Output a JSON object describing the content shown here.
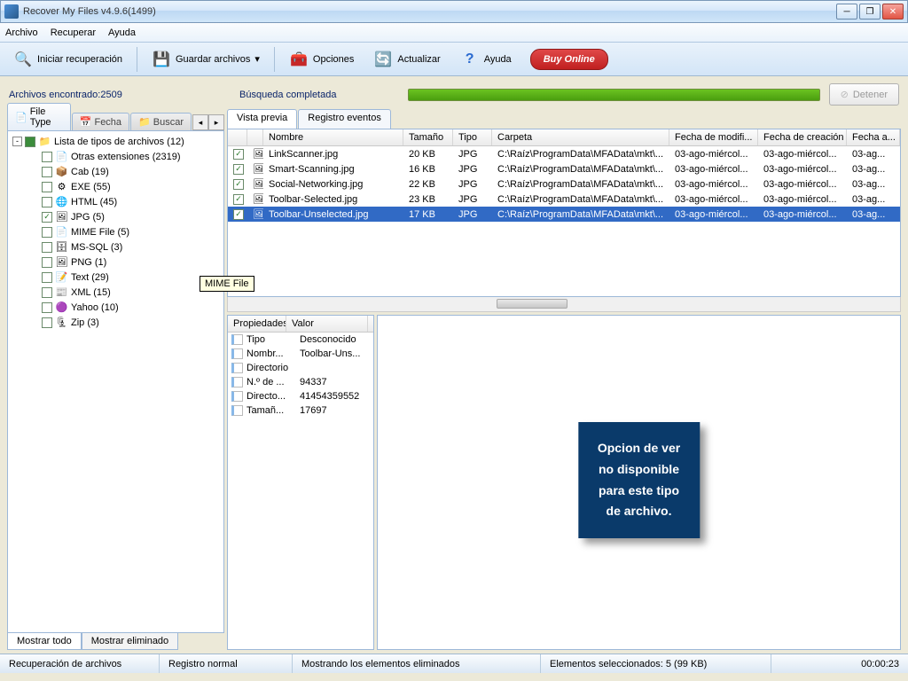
{
  "title": "Recover My Files v4.9.6(1499)",
  "menu": [
    "Archivo",
    "Recuperar",
    "Ayuda"
  ],
  "toolbar": {
    "start": "Iniciar recuperación",
    "save": "Guardar archivos",
    "options": "Opciones",
    "refresh": "Actualizar",
    "help": "Ayuda",
    "buy": "Buy Online"
  },
  "status": {
    "found": "Archivos encontrado:2509",
    "search": "Búsqueda completada",
    "stop": "Detener"
  },
  "lefttabs": {
    "filetype": "File Type",
    "fecha": "Fecha",
    "buscar": "Buscar"
  },
  "tree": [
    {
      "indent": 0,
      "exp": "-",
      "chk": "filled",
      "icon": "📁",
      "label": "Lista de tipos de archivos (12)"
    },
    {
      "indent": 1,
      "exp": "",
      "chk": "",
      "icon": "📄",
      "label": "Otras extensiones (2319)"
    },
    {
      "indent": 1,
      "exp": "",
      "chk": "",
      "icon": "📦",
      "label": "Cab (19)"
    },
    {
      "indent": 1,
      "exp": "",
      "chk": "",
      "icon": "⚙",
      "label": "EXE (55)"
    },
    {
      "indent": 1,
      "exp": "",
      "chk": "",
      "icon": "🌐",
      "label": "HTML (45)"
    },
    {
      "indent": 1,
      "exp": "",
      "chk": "✓",
      "icon": "🖼",
      "label": "JPG (5)"
    },
    {
      "indent": 1,
      "exp": "",
      "chk": "",
      "icon": "📄",
      "label": "MIME File (5)"
    },
    {
      "indent": 1,
      "exp": "",
      "chk": "",
      "icon": "🗄",
      "label": "MS-SQL (3)"
    },
    {
      "indent": 1,
      "exp": "",
      "chk": "",
      "icon": "🖼",
      "label": "PNG (1)"
    },
    {
      "indent": 1,
      "exp": "",
      "chk": "",
      "icon": "📝",
      "label": "Text (29)"
    },
    {
      "indent": 1,
      "exp": "",
      "chk": "",
      "icon": "📰",
      "label": "XML (15)"
    },
    {
      "indent": 1,
      "exp": "",
      "chk": "",
      "icon": "🟣",
      "label": "Yahoo (10)"
    },
    {
      "indent": 1,
      "exp": "",
      "chk": "",
      "icon": "🗜",
      "label": "Zip (3)"
    }
  ],
  "bottomtabs": {
    "all": "Mostrar todo",
    "deleted": "Mostrar eliminado"
  },
  "righttabs": {
    "preview": "Vista previa",
    "events": "Registro eventos"
  },
  "cols": [
    "",
    "",
    "Nombre",
    "Tamaño",
    "Tipo",
    "Carpeta",
    "Fecha de modifi...",
    "Fecha de creación",
    "Fecha a..."
  ],
  "rows": [
    {
      "sel": false,
      "name": "LinkScanner.jpg",
      "size": "20 KB",
      "type": "JPG",
      "folder": "C:\\Raíz\\ProgramData\\MFAData\\mkt\\...",
      "mod": "03-ago-miércol...",
      "cre": "03-ago-miércol...",
      "acc": "03-ag..."
    },
    {
      "sel": false,
      "name": "Smart-Scanning.jpg",
      "size": "16 KB",
      "type": "JPG",
      "folder": "C:\\Raíz\\ProgramData\\MFAData\\mkt\\...",
      "mod": "03-ago-miércol...",
      "cre": "03-ago-miércol...",
      "acc": "03-ag..."
    },
    {
      "sel": false,
      "name": "Social-Networking.jpg",
      "size": "22 KB",
      "type": "JPG",
      "folder": "C:\\Raíz\\ProgramData\\MFAData\\mkt\\...",
      "mod": "03-ago-miércol...",
      "cre": "03-ago-miércol...",
      "acc": "03-ag..."
    },
    {
      "sel": false,
      "name": "Toolbar-Selected.jpg",
      "size": "23 KB",
      "type": "JPG",
      "folder": "C:\\Raíz\\ProgramData\\MFAData\\mkt\\...",
      "mod": "03-ago-miércol...",
      "cre": "03-ago-miércol...",
      "acc": "03-ag..."
    },
    {
      "sel": true,
      "name": "Toolbar-Unselected.jpg",
      "size": "17 KB",
      "type": "JPG",
      "folder": "C:\\Raíz\\ProgramData\\MFAData\\mkt\\...",
      "mod": "03-ago-miércol...",
      "cre": "03-ago-miércol...",
      "acc": "03-ag..."
    }
  ],
  "props": {
    "h1": "Propiedades",
    "h2": "Valor",
    "items": [
      {
        "k": "Tipo",
        "v": "Desconocido"
      },
      {
        "k": "Nombr...",
        "v": "Toolbar-Uns..."
      },
      {
        "k": "Directorio",
        "v": ""
      },
      {
        "k": "N.º de ...",
        "v": "94337"
      },
      {
        "k": "Directo...",
        "v": "41454359552"
      },
      {
        "k": "Tamañ...",
        "v": "17697"
      }
    ]
  },
  "preview_msg": "Opcion de ver\nno disponible\npara este tipo\nde archivo.",
  "tooltip": "MIME File",
  "statusbar": {
    "a": "Recuperación de archivos",
    "b": "Registro normal",
    "c": "Mostrando los elementos eliminados",
    "d": "Elementos seleccionados: 5 (99 KB)",
    "e": "00:00:23"
  }
}
